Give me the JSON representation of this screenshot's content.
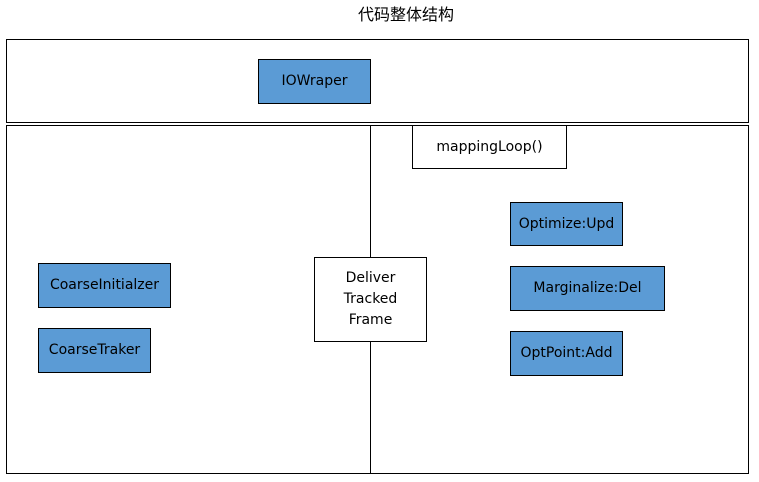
{
  "diagram": {
    "title": "代码整体结构",
    "top_section": {
      "io_wrapper_label": "IOWraper"
    },
    "left_section": {
      "coarse_initializer_label": "CoarseInitialzer",
      "coarse_tracker_label": "CoarseTraker"
    },
    "center": {
      "deliver_label_line1": "Deliver",
      "deliver_label_line2": "Tracked",
      "deliver_label_line3": "Frame"
    },
    "right_section": {
      "mapping_loop_label": "mappingLoop()",
      "optimize_label": "Optimize:Upd",
      "marginalize_label": "Marginalize:Del",
      "optpoint_label": "OptPoint:Add"
    },
    "colors": {
      "module_fill": "#5b9bd5",
      "outline": "#000000",
      "background": "#ffffff"
    }
  }
}
